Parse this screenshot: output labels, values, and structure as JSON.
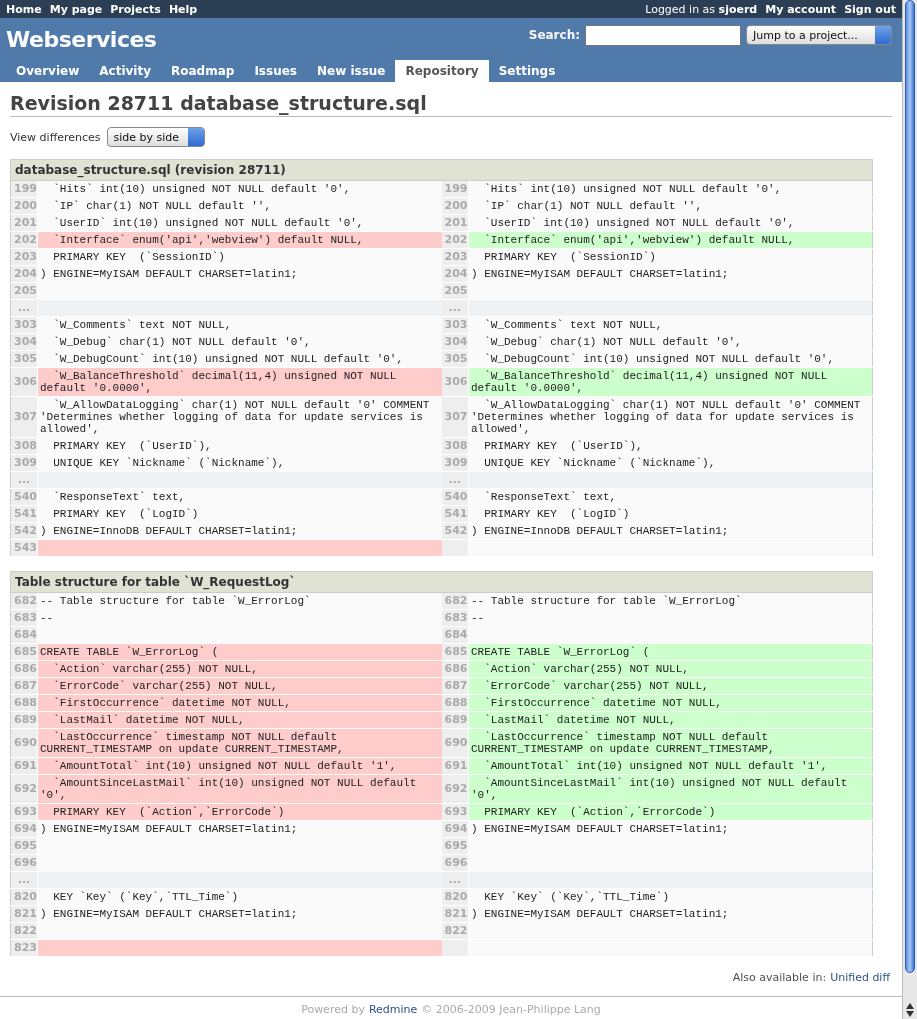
{
  "top_menu": {
    "items": [
      "Home",
      "My page",
      "Projects",
      "Help"
    ],
    "logged_in": "Logged in as **sjoerd**",
    "account_items": [
      "My account",
      "Sign out"
    ]
  },
  "header": {
    "title": "Webservices",
    "search_label": "Search:",
    "project_jump": "Jump to a project..."
  },
  "tabs": [
    {
      "label": "Overview",
      "selected": false
    },
    {
      "label": "Activity",
      "selected": false
    },
    {
      "label": "Roadmap",
      "selected": false
    },
    {
      "label": "Issues",
      "selected": false
    },
    {
      "label": "New issue",
      "selected": false
    },
    {
      "label": "Repository",
      "selected": true
    },
    {
      "label": "Settings",
      "selected": false
    }
  ],
  "page_title": "Revision 28711 database_structure.sql",
  "view_differences": {
    "label": "View differences",
    "value": "side by side"
  },
  "diffs": [
    {
      "title": "database_structure.sql (revision 28711)",
      "rows": [
        {
          "kind": "line",
          "left": {
            "num": "199",
            "code": "  `Hits` int(10) unsigned NOT NULL default '0',",
            "kind": "same"
          },
          "right": {
            "num": "199",
            "code": "  `Hits` int(10) unsigned NOT NULL default '0',",
            "kind": "same"
          }
        },
        {
          "kind": "line",
          "left": {
            "num": "200",
            "code": "  `IP` char(1) NOT NULL default '',",
            "kind": "same"
          },
          "right": {
            "num": "200",
            "code": "  `IP` char(1) NOT NULL default '',",
            "kind": "same"
          }
        },
        {
          "kind": "line",
          "left": {
            "num": "201",
            "code": "  `UserID` int(10) unsigned NOT NULL default '0',",
            "kind": "same"
          },
          "right": {
            "num": "201",
            "code": "  `UserID` int(10) unsigned NOT NULL default '0',",
            "kind": "same"
          }
        },
        {
          "kind": "line",
          "left": {
            "num": "202",
            "code": "  `Interface` enum('api','webview') default NULL,",
            "kind": "removed"
          },
          "right": {
            "num": "202",
            "code": "  `Interface` enum('api','webview') default NULL,",
            "kind": "added"
          }
        },
        {
          "kind": "line",
          "left": {
            "num": "203",
            "code": "  PRIMARY KEY  (`SessionID`)",
            "kind": "same"
          },
          "right": {
            "num": "203",
            "code": "  PRIMARY KEY  (`SessionID`)",
            "kind": "same"
          }
        },
        {
          "kind": "line",
          "left": {
            "num": "204",
            "code": ") ENGINE=MyISAM DEFAULT CHARSET=latin1;",
            "kind": "same"
          },
          "right": {
            "num": "204",
            "code": ") ENGINE=MyISAM DEFAULT CHARSET=latin1;",
            "kind": "same"
          }
        },
        {
          "kind": "line",
          "left": {
            "num": "205",
            "kind": "same"
          },
          "right": {
            "num": "205",
            "kind": "same"
          }
        },
        {
          "kind": "gap",
          "left": "...",
          "right": "..."
        },
        {
          "kind": "line",
          "left": {
            "num": "303",
            "code": "  `W_Comments` text NOT NULL,",
            "kind": "same"
          },
          "right": {
            "num": "303",
            "code": "  `W_Comments` text NOT NULL,",
            "kind": "same"
          }
        },
        {
          "kind": "line",
          "left": {
            "num": "304",
            "code": "  `W_Debug` char(1) NOT NULL default '0',",
            "kind": "same"
          },
          "right": {
            "num": "304",
            "code": "  `W_Debug` char(1) NOT NULL default '0',",
            "kind": "same"
          }
        },
        {
          "kind": "line",
          "left": {
            "num": "305",
            "code": "  `W_DebugCount` int(10) unsigned NOT NULL default '0',",
            "kind": "same"
          },
          "right": {
            "num": "305",
            "code": "  `W_DebugCount` int(10) unsigned NOT NULL default '0',",
            "kind": "same"
          }
        },
        {
          "kind": "line",
          "left": {
            "num": "306",
            "code": "  `W_BalanceThreshold` decimal(11,4) unsigned NOT NULL default '0.0000',",
            "kind": "removed"
          },
          "right": {
            "num": "306",
            "code": "  `W_BalanceThreshold` decimal(11,4) unsigned NOT NULL default '0.0000',",
            "kind": "added"
          }
        },
        {
          "kind": "line",
          "left": {
            "num": "307",
            "code": "  `W_AllowDataLogging` char(1) NOT NULL default '0' COMMENT 'Determines whether logging of data for update services is allowed',",
            "kind": "same"
          },
          "right": {
            "num": "307",
            "code": "  `W_AllowDataLogging` char(1) NOT NULL default '0' COMMENT 'Determines whether logging of data for update services is allowed',",
            "kind": "same"
          }
        },
        {
          "kind": "line",
          "left": {
            "num": "308",
            "code": "  PRIMARY KEY  (`UserID`),",
            "kind": "same"
          },
          "right": {
            "num": "308",
            "code": "  PRIMARY KEY  (`UserID`),",
            "kind": "same"
          }
        },
        {
          "kind": "line",
          "left": {
            "num": "309",
            "code": "  UNIQUE KEY `Nickname` (`Nickname`),",
            "kind": "same"
          },
          "right": {
            "num": "309",
            "code": "  UNIQUE KEY `Nickname` (`Nickname`),",
            "kind": "same"
          }
        },
        {
          "kind": "gap",
          "left": "...",
          "right": "..."
        },
        {
          "kind": "line",
          "left": {
            "num": "540",
            "code": "  `ResponseText` text,",
            "kind": "same"
          },
          "right": {
            "num": "540",
            "code": "  `ResponseText` text,",
            "kind": "same"
          }
        },
        {
          "kind": "line",
          "left": {
            "num": "541",
            "code": "  PRIMARY KEY  (`LogID`)",
            "kind": "same"
          },
          "right": {
            "num": "541",
            "code": "  PRIMARY KEY  (`LogID`)",
            "kind": "same"
          }
        },
        {
          "kind": "line",
          "left": {
            "num": "542",
            "code": ") ENGINE=InnoDB DEFAULT CHARSET=latin1;",
            "kind": "same"
          },
          "right": {
            "num": "542",
            "code": ") ENGINE=InnoDB DEFAULT CHARSET=latin1;",
            "kind": "same"
          }
        },
        {
          "kind": "line",
          "left": {
            "num": "543",
            "kind": "removed"
          },
          "right": {
            "kind": "none"
          }
        }
      ]
    },
    {
      "title": "Table structure for table `W_RequestLog`",
      "rows": [
        {
          "kind": "line",
          "left": {
            "num": "682",
            "code": "-- Table structure for table `W_ErrorLog`",
            "kind": "same"
          },
          "right": {
            "num": "682",
            "code": "-- Table structure for table `W_ErrorLog`",
            "kind": "same"
          }
        },
        {
          "kind": "line",
          "left": {
            "num": "683",
            "code": "--",
            "kind": "same"
          },
          "right": {
            "num": "683",
            "code": "--",
            "kind": "same"
          }
        },
        {
          "kind": "line",
          "left": {
            "num": "684",
            "kind": "same"
          },
          "right": {
            "num": "684",
            "kind": "same"
          }
        },
        {
          "kind": "line",
          "left": {
            "num": "685",
            "code": "CREATE TABLE `W_ErrorLog` (",
            "kind": "removed"
          },
          "right": {
            "num": "685",
            "code": "CREATE TABLE `W_ErrorLog` (",
            "kind": "added"
          }
        },
        {
          "kind": "line",
          "left": {
            "num": "686",
            "code": "  `Action` varchar(255) NOT NULL,",
            "kind": "removed"
          },
          "right": {
            "num": "686",
            "code": "  `Action` varchar(255) NOT NULL,",
            "kind": "added"
          }
        },
        {
          "kind": "line",
          "left": {
            "num": "687",
            "code": "  `ErrorCode` varchar(255) NOT NULL,",
            "kind": "removed"
          },
          "right": {
            "num": "687",
            "code": "  `ErrorCode` varchar(255) NOT NULL,",
            "kind": "added"
          }
        },
        {
          "kind": "line",
          "left": {
            "num": "688",
            "code": "  `FirstOccurrence` datetime NOT NULL,",
            "kind": "removed"
          },
          "right": {
            "num": "688",
            "code": "  `FirstOccurrence` datetime NOT NULL,",
            "kind": "added"
          }
        },
        {
          "kind": "line",
          "left": {
            "num": "689",
            "code": "  `LastMail` datetime NOT NULL,",
            "kind": "removed"
          },
          "right": {
            "num": "689",
            "code": "  `LastMail` datetime NOT NULL,",
            "kind": "added"
          }
        },
        {
          "kind": "line",
          "left": {
            "num": "690",
            "code": "  `LastOccurrence` timestamp NOT NULL default CURRENT_TIMESTAMP on update CURRENT_TIMESTAMP,",
            "kind": "removed"
          },
          "right": {
            "num": "690",
            "code": "  `LastOccurrence` timestamp NOT NULL default CURRENT_TIMESTAMP on update CURRENT_TIMESTAMP,",
            "kind": "added"
          }
        },
        {
          "kind": "line",
          "left": {
            "num": "691",
            "code": "  `AmountTotal` int(10) unsigned NOT NULL default '1',",
            "kind": "removed"
          },
          "right": {
            "num": "691",
            "code": "  `AmountTotal` int(10) unsigned NOT NULL default '1',",
            "kind": "added"
          }
        },
        {
          "kind": "line",
          "left": {
            "num": "692",
            "code": "  `AmountSinceLastMail` int(10) unsigned NOT NULL default '0',",
            "kind": "removed"
          },
          "right": {
            "num": "692",
            "code": "  `AmountSinceLastMail` int(10) unsigned NOT NULL default '0',",
            "kind": "added"
          }
        },
        {
          "kind": "line",
          "left": {
            "num": "693",
            "code": "  PRIMARY KEY  (`Action`,`ErrorCode`)",
            "kind": "removed"
          },
          "right": {
            "num": "693",
            "code": "  PRIMARY KEY  (`Action`,`ErrorCode`)",
            "kind": "added"
          }
        },
        {
          "kind": "line",
          "left": {
            "num": "694",
            "code": ") ENGINE=MyISAM DEFAULT CHARSET=latin1;",
            "kind": "same"
          },
          "right": {
            "num": "694",
            "code": ") ENGINE=MyISAM DEFAULT CHARSET=latin1;",
            "kind": "same"
          }
        },
        {
          "kind": "line",
          "left": {
            "num": "695",
            "kind": "same"
          },
          "right": {
            "num": "695",
            "kind": "same"
          }
        },
        {
          "kind": "line",
          "left": {
            "num": "696",
            "kind": "same"
          },
          "right": {
            "num": "696",
            "kind": "same"
          }
        },
        {
          "kind": "gap",
          "left": "...",
          "right": "..."
        },
        {
          "kind": "line",
          "left": {
            "num": "820",
            "code": "  KEY `Key` (`Key`,`TTL_Time`)",
            "kind": "same"
          },
          "right": {
            "num": "820",
            "code": "  KEY `Key` (`Key`,`TTL_Time`)",
            "kind": "same"
          }
        },
        {
          "kind": "line",
          "left": {
            "num": "821",
            "code": ") ENGINE=MyISAM DEFAULT CHARSET=latin1;",
            "kind": "same"
          },
          "right": {
            "num": "821",
            "code": ") ENGINE=MyISAM DEFAULT CHARSET=latin1;",
            "kind": "same"
          }
        },
        {
          "kind": "line",
          "left": {
            "num": "822",
            "kind": "same"
          },
          "right": {
            "num": "822",
            "kind": "same"
          }
        },
        {
          "kind": "line",
          "left": {
            "num": "823",
            "kind": "removed"
          },
          "right": {
            "kind": "none"
          }
        }
      ]
    }
  ],
  "also_available": {
    "label": "Also available in:",
    "link": "Unified diff"
  },
  "footer": {
    "prefix": "Powered by",
    "link": "Redmine",
    "suffix": "© 2006-2009 Jean-Philippe Lang"
  }
}
